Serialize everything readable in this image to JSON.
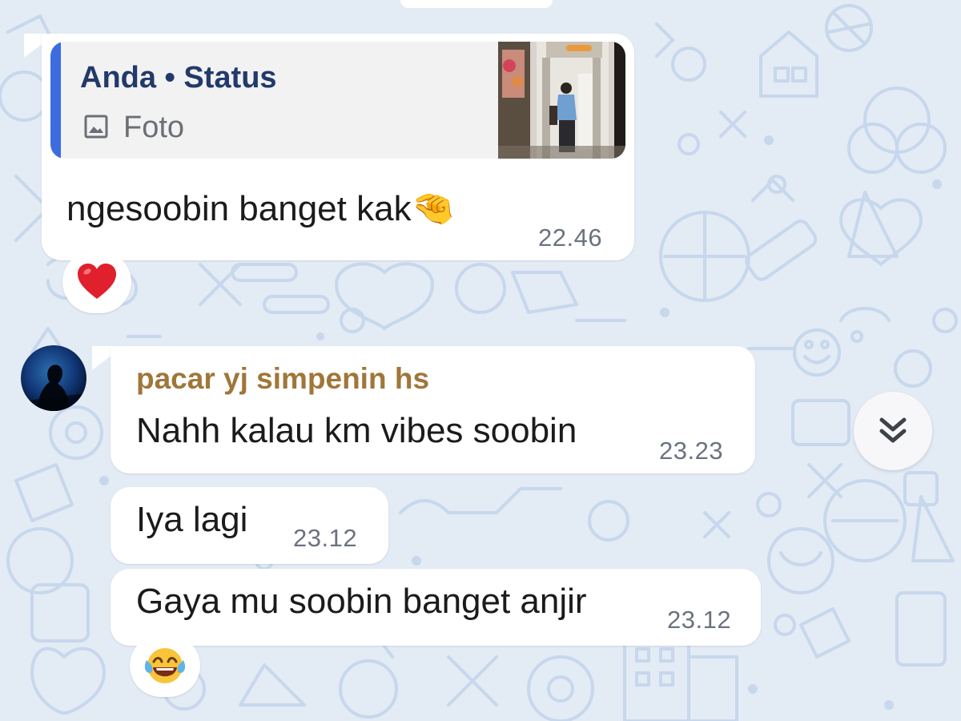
{
  "messages": [
    {
      "direction": "outgoing",
      "quote": {
        "title": "Anda • Status",
        "type_label": "Foto",
        "type_icon": "photo-icon"
      },
      "text": "ngesoobin banget kak🤏",
      "time": "22.46",
      "reaction": "❤️"
    },
    {
      "direction": "incoming",
      "sender": "pacar yj simpenin hs",
      "text": "Nahh kalau km vibes soobin",
      "time": "23.23"
    },
    {
      "direction": "incoming",
      "text": "Iya lagi",
      "time": "23.12"
    },
    {
      "direction": "incoming",
      "text": "Gaya mu soobin banget anjir",
      "time": "23.12",
      "reaction": "😂"
    }
  ],
  "scroll_button": {
    "icon": "double-chevron-down-icon"
  },
  "colors": {
    "wallpaper": "#e3ebf5",
    "doodle": "#c5d6ec",
    "bubble": "#ffffff",
    "quote_accent": "#3d6ce0",
    "quote_title": "#22396b",
    "sender_name": "#a07639",
    "timestamp": "#6b7280"
  }
}
